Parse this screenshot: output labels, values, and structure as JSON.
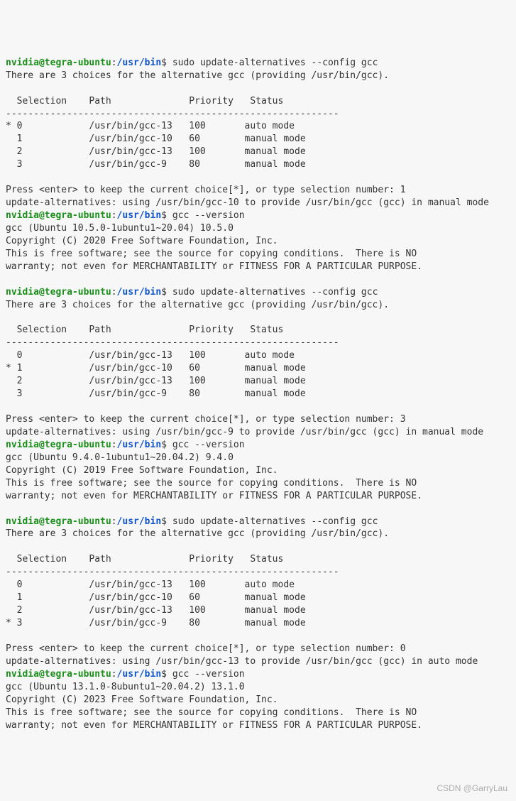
{
  "prompt": {
    "user": "nvidia@tegra-ubuntu",
    "colon": ":",
    "path": "/usr/bin",
    "dollar": "$ "
  },
  "cmd": {
    "update_alt": "sudo update-alternatives --config gcc",
    "gcc_version": "gcc --version"
  },
  "choices_line": "There are 3 choices for the alternative gcc (providing /usr/bin/gcc).",
  "table_header": "  Selection    Path              Priority   Status",
  "table_divider": "------------------------------------------------------------",
  "table1": {
    "row0": "* 0            /usr/bin/gcc-13   100       auto mode",
    "row1": "  1            /usr/bin/gcc-10   60        manual mode",
    "row2": "  2            /usr/bin/gcc-13   100       manual mode",
    "row3": "  3            /usr/bin/gcc-9    80        manual mode"
  },
  "press1": "Press <enter> to keep the current choice[*], or type selection number: 1",
  "result1": "update-alternatives: using /usr/bin/gcc-10 to provide /usr/bin/gcc (gcc) in manual mode",
  "gccver1": {
    "l1": "gcc (Ubuntu 10.5.0-1ubuntu1~20.04) 10.5.0",
    "l2": "Copyright (C) 2020 Free Software Foundation, Inc.",
    "l3": "This is free software; see the source for copying conditions.  There is NO",
    "l4": "warranty; not even for MERCHANTABILITY or FITNESS FOR A PARTICULAR PURPOSE."
  },
  "table2": {
    "row0": "  0            /usr/bin/gcc-13   100       auto mode",
    "row1": "* 1            /usr/bin/gcc-10   60        manual mode",
    "row2": "  2            /usr/bin/gcc-13   100       manual mode",
    "row3": "  3            /usr/bin/gcc-9    80        manual mode"
  },
  "press2": "Press <enter> to keep the current choice[*], or type selection number: 3",
  "result2": "update-alternatives: using /usr/bin/gcc-9 to provide /usr/bin/gcc (gcc) in manual mode",
  "gccver2": {
    "l1": "gcc (Ubuntu 9.4.0-1ubuntu1~20.04.2) 9.4.0",
    "l2": "Copyright (C) 2019 Free Software Foundation, Inc.",
    "l3": "This is free software; see the source for copying conditions.  There is NO",
    "l4": "warranty; not even for MERCHANTABILITY or FITNESS FOR A PARTICULAR PURPOSE."
  },
  "table3": {
    "row0": "  0            /usr/bin/gcc-13   100       auto mode",
    "row1": "  1            /usr/bin/gcc-10   60        manual mode",
    "row2": "  2            /usr/bin/gcc-13   100       manual mode",
    "row3": "* 3            /usr/bin/gcc-9    80        manual mode"
  },
  "press3": "Press <enter> to keep the current choice[*], or type selection number: 0",
  "result3": "update-alternatives: using /usr/bin/gcc-13 to provide /usr/bin/gcc (gcc) in auto mode",
  "gccver3": {
    "l1": "gcc (Ubuntu 13.1.0-8ubuntu1~20.04.2) 13.1.0",
    "l2": "Copyright (C) 2023 Free Software Foundation, Inc.",
    "l3": "This is free software; see the source for copying conditions.  There is NO",
    "l4": "warranty; not even for MERCHANTABILITY or FITNESS FOR A PARTICULAR PURPOSE."
  },
  "watermark": "CSDN @GarryLau"
}
